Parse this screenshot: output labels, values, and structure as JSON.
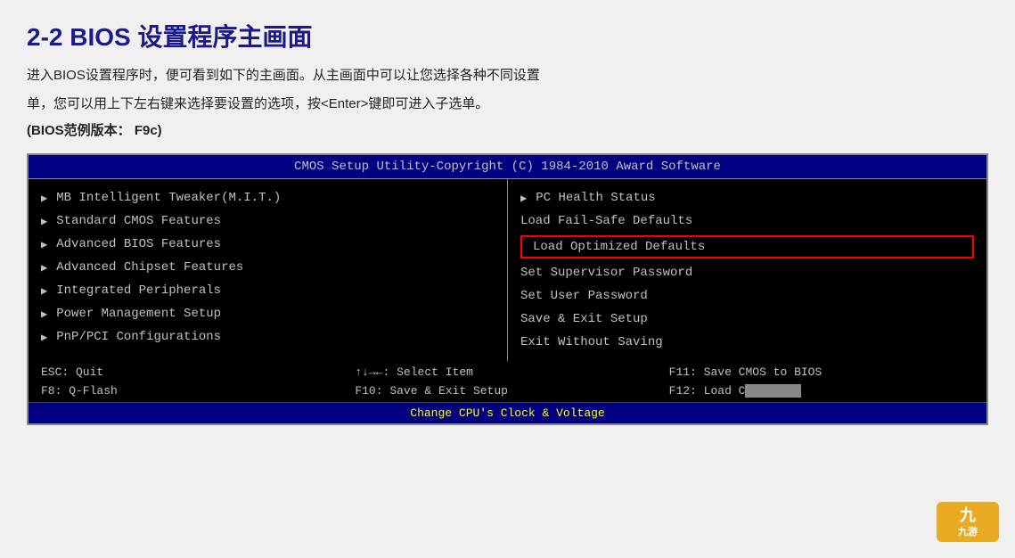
{
  "page": {
    "title": "2-2   BIOS 设置程序主画面",
    "description1": "进入BIOS设置程序时，便可看到如下的主画面。从主画面中可以让您选择各种不同设置",
    "description2": "单，您可以用上下左右键来选择要设置的选项，按<Enter>键即可进入子选单。",
    "version": "(BIOS范例版本：  F9c)"
  },
  "bios": {
    "header": "CMOS Setup Utility-Copyright (C) 1984-2010 Award Software",
    "left_items": [
      {
        "label": "MB Intelligent Tweaker(M.I.T.)",
        "has_arrow": true
      },
      {
        "label": "Standard CMOS Features",
        "has_arrow": true
      },
      {
        "label": "Advanced BIOS Features",
        "has_arrow": true
      },
      {
        "label": "Advanced Chipset Features",
        "has_arrow": true
      },
      {
        "label": "Integrated Peripherals",
        "has_arrow": true
      },
      {
        "label": "Power Management Setup",
        "has_arrow": true
      },
      {
        "label": "PnP/PCI Configurations",
        "has_arrow": true
      }
    ],
    "right_items": [
      {
        "label": "PC Health Status",
        "has_arrow": true,
        "highlighted": false
      },
      {
        "label": "Load Fail-Safe Defaults",
        "has_arrow": false,
        "highlighted": false
      },
      {
        "label": "Load Optimized Defaults",
        "has_arrow": false,
        "highlighted": true
      },
      {
        "label": "Set Supervisor Password",
        "has_arrow": false,
        "highlighted": false
      },
      {
        "label": "Set User Password",
        "has_arrow": false,
        "highlighted": false
      },
      {
        "label": "Save & Exit Setup",
        "has_arrow": false,
        "highlighted": false
      },
      {
        "label": "Exit Without Saving",
        "has_arrow": false,
        "highlighted": false
      }
    ],
    "footer": {
      "row1_col1": "ESC: Quit",
      "row1_col2": "↑↓→←: Select Item",
      "row1_col3": "F11: Save CMOS to BIOS",
      "row2_col1": "F8: Q-Flash",
      "row2_col2": "F10: Save & Exit Setup",
      "row2_col3": "F12: Load C●●●● ●●●",
      "status": "Change CPU's Clock & Voltage"
    }
  },
  "watermark": {
    "label": "九游"
  }
}
